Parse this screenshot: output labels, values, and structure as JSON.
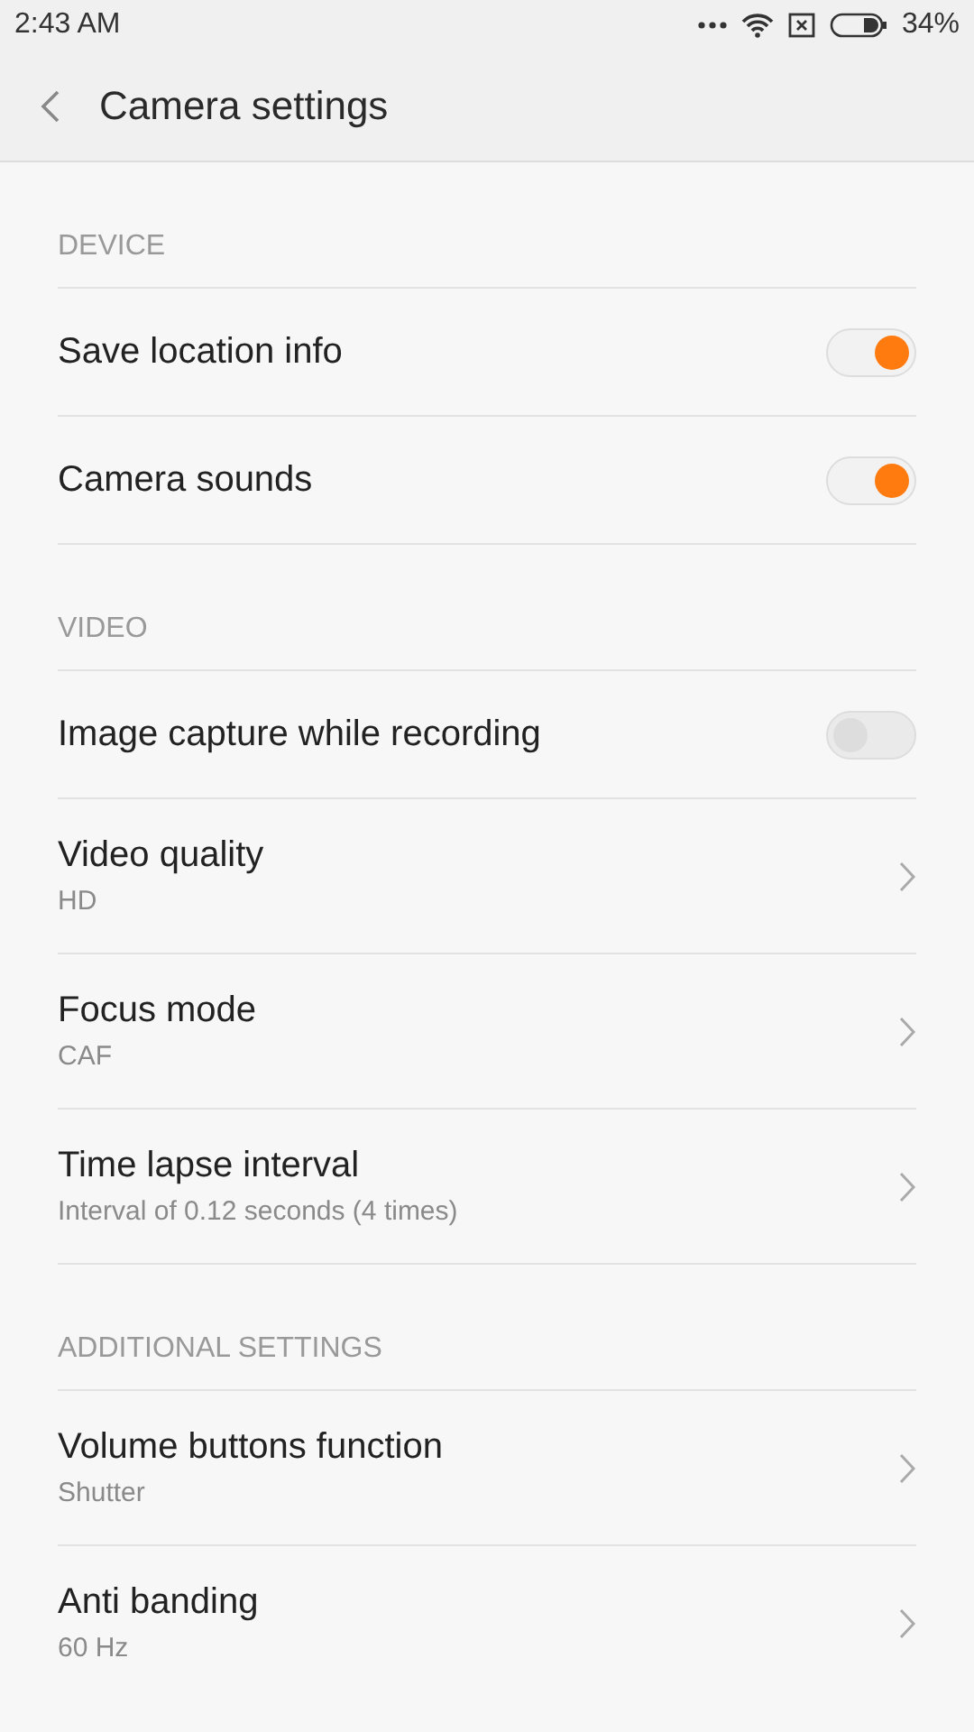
{
  "status_bar": {
    "time": "2:43 AM",
    "battery": "34%"
  },
  "header": {
    "title": "Camera settings"
  },
  "sections": [
    {
      "title": "DEVICE",
      "items": [
        {
          "kind": "toggle",
          "label": "Save location info",
          "on": true
        },
        {
          "kind": "toggle",
          "label": "Camera sounds",
          "on": true
        }
      ]
    },
    {
      "title": "VIDEO",
      "items": [
        {
          "kind": "toggle",
          "label": "Image capture while recording",
          "on": false
        },
        {
          "kind": "nav",
          "label": "Video quality",
          "value": "HD"
        },
        {
          "kind": "nav",
          "label": "Focus mode",
          "value": "CAF"
        },
        {
          "kind": "nav",
          "label": "Time lapse interval",
          "value": "Interval of 0.12 seconds (4 times)"
        }
      ]
    },
    {
      "title": "ADDITIONAL SETTINGS",
      "items": [
        {
          "kind": "nav",
          "label": "Volume buttons function",
          "value": "Shutter"
        },
        {
          "kind": "nav",
          "label": "Anti banding",
          "value": "60 Hz"
        }
      ]
    }
  ]
}
